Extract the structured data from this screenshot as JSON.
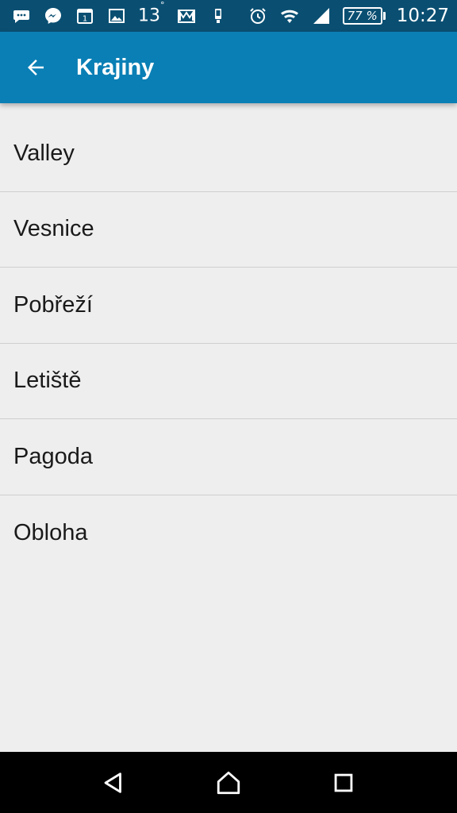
{
  "status_bar": {
    "temperature": "13",
    "temperature_unit": "°",
    "battery": "77 %",
    "time": "10:27",
    "left_icons": [
      "chat-bubble-icon",
      "messenger-icon",
      "calendar-icon",
      "gallery-icon"
    ],
    "right_icons": [
      "alarm-icon",
      "wifi-icon",
      "signal-icon",
      "battery-icon"
    ],
    "calendar_day": "1"
  },
  "app_bar": {
    "title": "Krajiny",
    "back_icon": "arrow-back-icon",
    "background": "#0a7fb5"
  },
  "list": {
    "items": [
      {
        "label": "Valley"
      },
      {
        "label": "Vesnice"
      },
      {
        "label": "Pobřeží"
      },
      {
        "label": "Letiště"
      },
      {
        "label": "Pagoda"
      },
      {
        "label": "Obloha"
      }
    ]
  },
  "nav_bar": {
    "icons": [
      "back-triangle-icon",
      "home-icon",
      "recents-icon"
    ]
  },
  "colors": {
    "status_bar": "#0a4f72",
    "app_bar": "#0a7fb5",
    "background": "#eeeeee",
    "divider": "#cfcfcf"
  }
}
